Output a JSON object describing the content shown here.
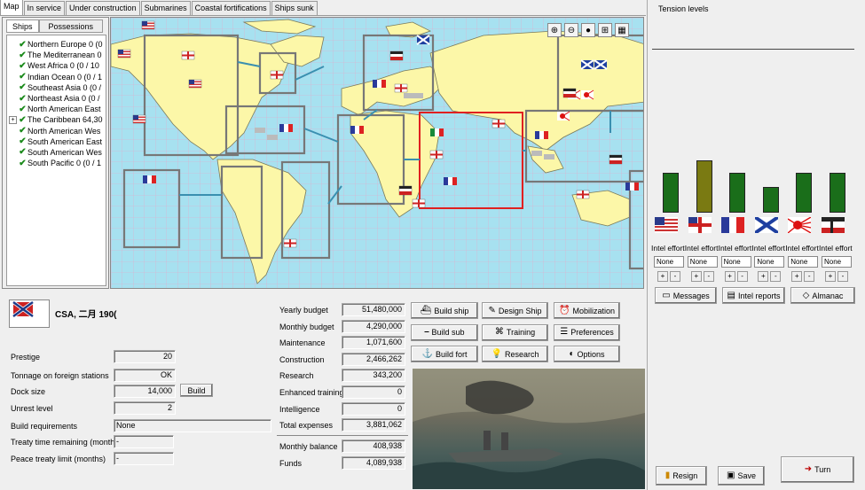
{
  "tabs": [
    "Map",
    "In service",
    "Under construction",
    "Submarines",
    "Coastal fortifications",
    "Ships sunk"
  ],
  "sidebar": {
    "tabs": [
      "Ships",
      "Possessions"
    ],
    "items": [
      {
        "label": "Northern Europe 0 (0",
        "expand": false
      },
      {
        "label": "The Mediterranean 0",
        "expand": false
      },
      {
        "label": "West Africa 0 (0 / 10",
        "expand": false
      },
      {
        "label": "Indian Ocean 0 (0 / 1",
        "expand": false
      },
      {
        "label": "Southeast Asia 0 (0 /",
        "expand": false
      },
      {
        "label": "Northeast Asia 0 (0 /",
        "expand": false
      },
      {
        "label": "North American East",
        "expand": false
      },
      {
        "label": "The Caribbean 64,30",
        "expand": true
      },
      {
        "label": "North American Wes",
        "expand": false
      },
      {
        "label": "South American East",
        "expand": false
      },
      {
        "label": "South American Wes",
        "expand": false
      },
      {
        "label": "South Pacific 0 (0 / 1",
        "expand": false
      }
    ]
  },
  "map_tools": [
    "zoom-in-icon",
    "zoom-out-icon",
    "oil-icon",
    "fleet-icon",
    "table-icon"
  ],
  "nation": {
    "name": "CSA, 二月 190("
  },
  "stats": [
    {
      "label": "Prestige",
      "value": "20"
    },
    {
      "label": "Tonnage on foreign stations",
      "value": "OK"
    },
    {
      "label": "Dock size",
      "value": "14,000"
    },
    {
      "label": "Unrest level",
      "value": "2"
    },
    {
      "label": "Build requirements",
      "value": "None"
    },
    {
      "label": "Treaty time remaining (months)",
      "value": "-"
    },
    {
      "label": "Peace treaty limit (months)",
      "value": "-"
    }
  ],
  "build_dock_label": "Build",
  "budget": [
    {
      "label": "Yearly budget",
      "value": "51,480,000"
    },
    {
      "label": "Monthly budget",
      "value": "4,290,000"
    },
    {
      "label": "Maintenance",
      "value": "1,071,600"
    },
    {
      "label": "Construction",
      "value": "2,466,262"
    },
    {
      "label": "Research",
      "value": "343,200"
    },
    {
      "label": "Enhanced training",
      "value": "0"
    },
    {
      "label": "Intelligence",
      "value": "0"
    },
    {
      "label": "Total expenses",
      "value": "3,881,062"
    }
  ],
  "balance": [
    {
      "label": "Monthly balance",
      "value": "408,938"
    },
    {
      "label": "Funds",
      "value": "4,089,938"
    }
  ],
  "actions": [
    [
      "Build ship",
      "Design Ship",
      "Mobilization"
    ],
    [
      "Build sub",
      "Training",
      "Preferences"
    ],
    [
      "Build fort",
      "Research",
      "Options"
    ]
  ],
  "tension": {
    "title": "Tension levels",
    "levels": [
      {
        "nation": "USA",
        "value": 0.62,
        "color": "#1a6e1a"
      },
      {
        "nation": "UK",
        "value": 0.82,
        "color": "#7a7a12"
      },
      {
        "nation": "France",
        "value": 0.62,
        "color": "#1a6e1a"
      },
      {
        "nation": "Russia",
        "value": 0.4,
        "color": "#1a6e1a"
      },
      {
        "nation": "Japan",
        "value": 0.62,
        "color": "#1a6e1a"
      },
      {
        "nation": "Germany",
        "value": 0.62,
        "color": "#1a6e1a"
      }
    ],
    "intel_label": "Intel effort",
    "intel_value": "None"
  },
  "side_buttons": [
    "Messages",
    "Intel reports",
    "Almanac"
  ],
  "bottom_buttons": {
    "resign": "Resign",
    "save": "Save",
    "turn": "Turn"
  }
}
